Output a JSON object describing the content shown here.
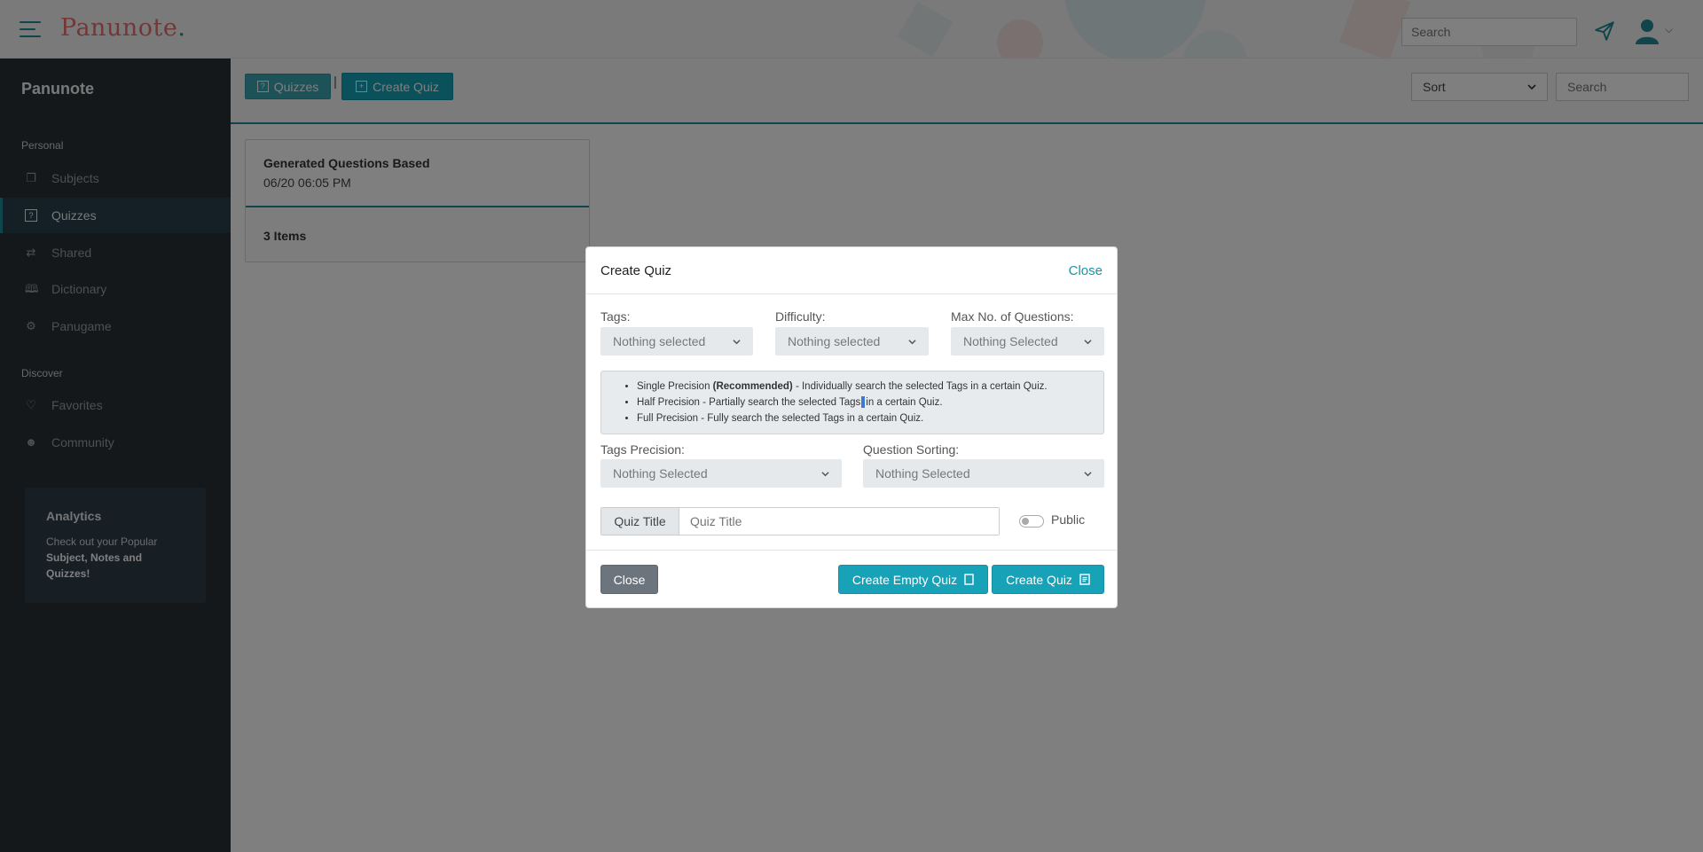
{
  "header": {
    "logo_text": "Panunote",
    "logo_dot": ".",
    "search_placeholder": "Search"
  },
  "sidebar": {
    "brand": "Panunote",
    "section_personal": "Personal",
    "section_discover": "Discover",
    "items": [
      {
        "label": "Subjects",
        "icon": "notes-icon"
      },
      {
        "label": "Quizzes",
        "icon": "question-box-icon",
        "active": true
      },
      {
        "label": "Shared",
        "icon": "share-icon"
      },
      {
        "label": "Dictionary",
        "icon": "book-icon"
      },
      {
        "label": "Panugame",
        "icon": "gamepad-icon"
      },
      {
        "label": "Favorites",
        "icon": "heart-icon"
      },
      {
        "label": "Community",
        "icon": "people-icon"
      }
    ],
    "analytics": {
      "title": "Analytics",
      "desc_prefix": "Check out your Popular ",
      "desc_bold": "Subject, Notes and Quizzes!"
    }
  },
  "toolbar": {
    "quizzes_label": "Quizzes",
    "separator": "|",
    "create_quiz_label": "Create Quiz",
    "sort_label": "Sort",
    "search_placeholder": "Search"
  },
  "quiz_card": {
    "title": "Generated Questions Based",
    "date": "06/20 06:05 PM",
    "items": "3 Items"
  },
  "modal": {
    "title": "Create Quiz",
    "close_link": "Close",
    "tags_label": "Tags:",
    "tags_value": "Nothing selected",
    "difficulty_label": "Difficulty:",
    "difficulty_value": "Nothing selected",
    "max_label": "Max No. of Questions:",
    "max_value": "Nothing Selected",
    "info": {
      "single_a": "Single Precision ",
      "single_bold": "(Recommended)",
      "single_b": " - Individually search the selected Tags in a certain Quiz.",
      "half_a": "Half Precision - Partially search the selected Tags",
      "half_b": "in a certain Quiz.",
      "full": "Full Precision - Fully search the selected Tags in a certain Quiz."
    },
    "precision_label": "Tags Precision:",
    "precision_value": "Nothing Selected",
    "sorting_label": "Question Sorting:",
    "sorting_value": "Nothing Selected",
    "quiz_title_addon": "Quiz Title",
    "quiz_title_placeholder": "Quiz Title",
    "public_label": "Public",
    "close_button": "Close",
    "create_empty_button": "Create Empty Quiz",
    "create_button": "Create Quiz"
  },
  "colors": {
    "accent": "#17a2b8",
    "sidebar_bg": "#2b3036",
    "logo": "#e96f6f"
  }
}
